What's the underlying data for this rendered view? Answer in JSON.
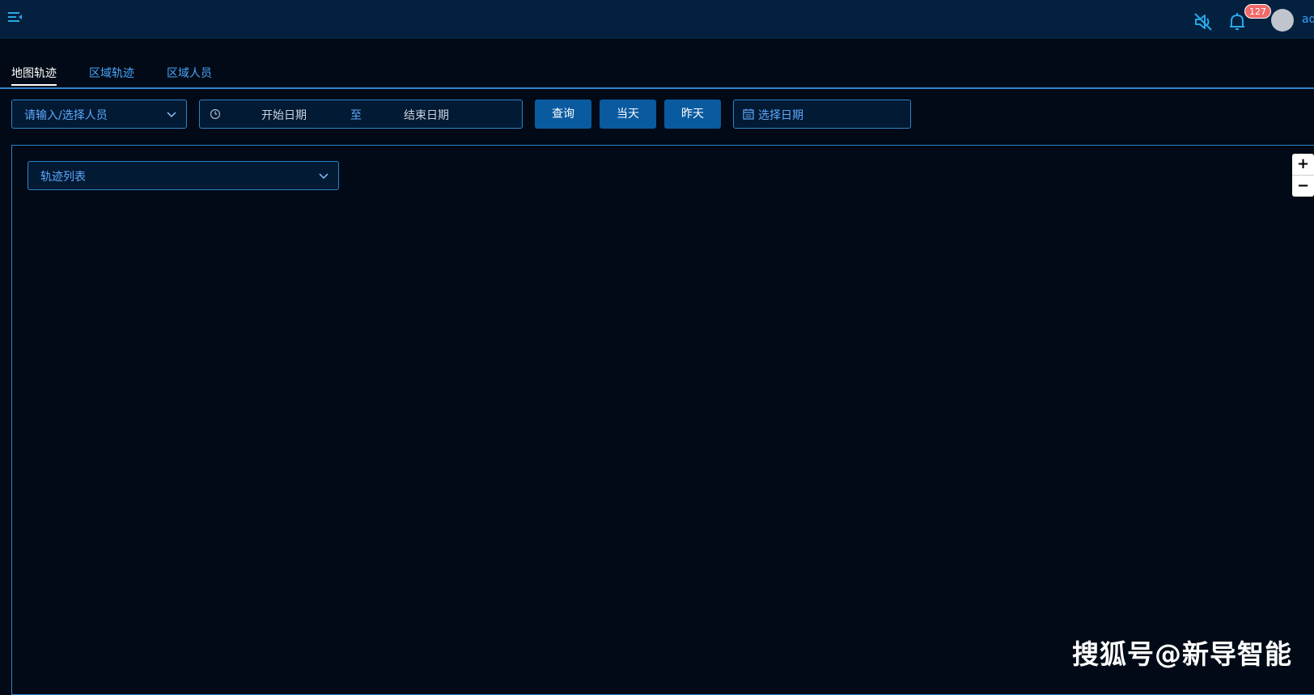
{
  "header": {
    "badge_count": "127",
    "username": "admin"
  },
  "tabs": [
    {
      "label": "地图轨迹",
      "active": true
    },
    {
      "label": "区域轨迹",
      "active": false
    },
    {
      "label": "区域人员",
      "active": false
    }
  ],
  "filters": {
    "person_placeholder": "请输入/选择人员",
    "start_placeholder": "开始日期",
    "range_separator": "至",
    "end_placeholder": "结束日期",
    "query_label": "查询",
    "today_label": "当天",
    "yesterday_label": "昨天",
    "date_placeholder": "选择日期"
  },
  "map": {
    "track_list_label": "轨迹列表",
    "zoom_in": "+",
    "zoom_out": "−"
  },
  "watermark": "搜狐号@新导智能",
  "colors": {
    "background": "#010a16",
    "topbar": "#03213f",
    "accent": "#2f83c8",
    "button": "#0a5aa0",
    "badge": "#f06a6a"
  }
}
